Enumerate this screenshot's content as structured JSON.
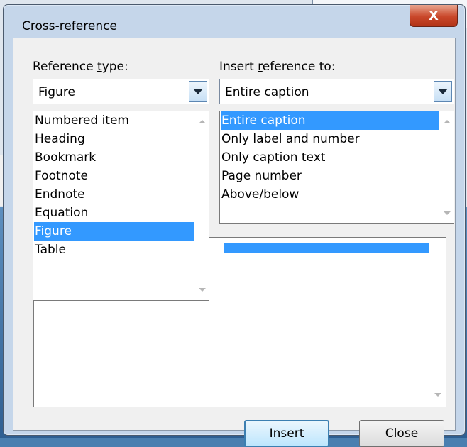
{
  "dialog": {
    "title": "Cross-reference",
    "close_label": "X",
    "reference_type": {
      "label_pre": "Reference ",
      "label_accel": "t",
      "label_post": "ype:",
      "selected": "Figure",
      "options": [
        "Numbered item",
        "Heading",
        "Bookmark",
        "Footnote",
        "Endnote",
        "Equation",
        "Figure",
        "Table"
      ]
    },
    "insert_reference_to": {
      "label_pre": "Insert ",
      "label_accel": "r",
      "label_post": "eference to:",
      "selected": "Entire caption",
      "options": [
        "Entire caption",
        "Only label and number",
        "Only caption text",
        "Page number",
        "Above/below"
      ]
    },
    "buttons": {
      "insert_accel": "I",
      "insert_post": "nsert",
      "close": "Close"
    },
    "colors": {
      "selection": "#3399ff",
      "frame": "#c5d6ea",
      "close_button": "#c9472a"
    }
  }
}
